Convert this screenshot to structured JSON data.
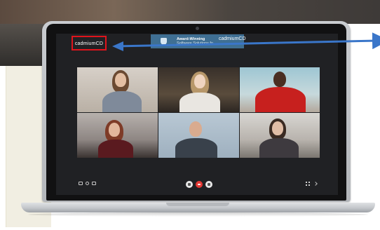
{
  "brand": {
    "name": "cadmiumCD",
    "highlight_color": "#e0141c"
  },
  "banner": {
    "title": "Award-Winning",
    "subtitle": "Software Solutions fo",
    "logo_text": "cadmiumCD",
    "background": "#3f6f93"
  },
  "pointer": {
    "color": "#3a76c9"
  },
  "video_call": {
    "participant_count": 6,
    "controls": {
      "left": [
        "screen-share-icon",
        "microphone-icon",
        "camera-icon"
      ],
      "center": [
        "mute-icon",
        "end-call-icon",
        "video-icon"
      ],
      "right": [
        "grid-view-icon",
        "more-icon"
      ]
    },
    "end_call_color": "#e53935"
  }
}
